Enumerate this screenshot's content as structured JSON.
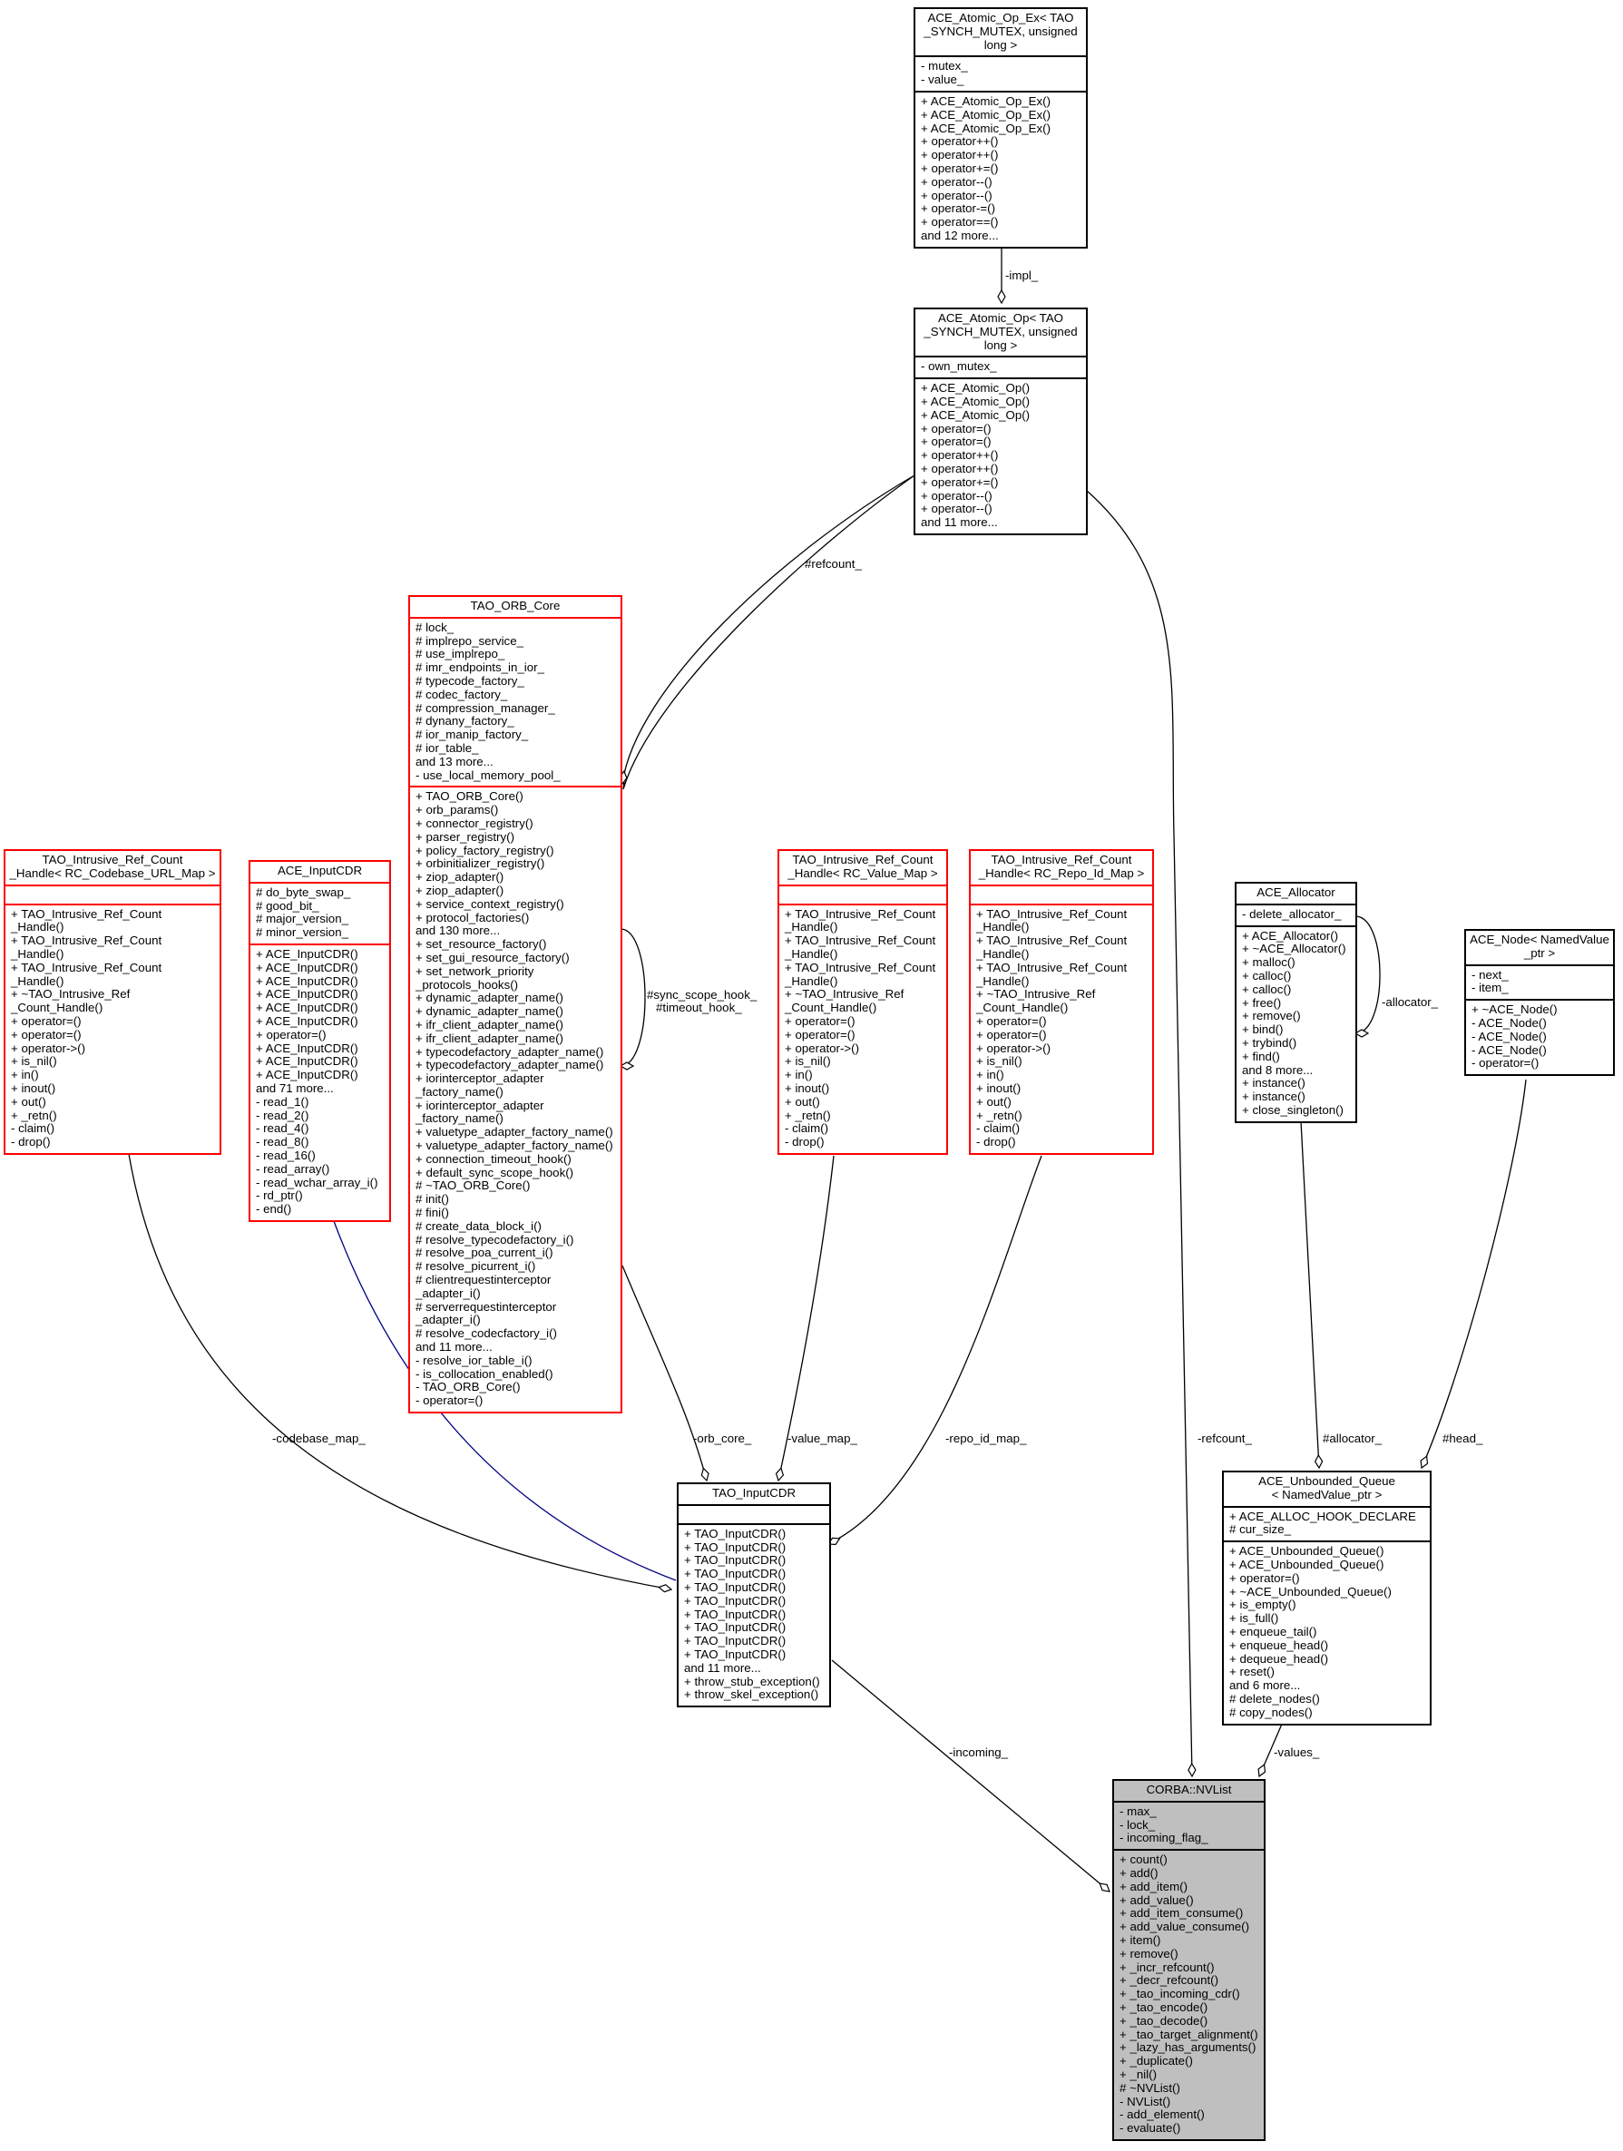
{
  "nodes": {
    "atomic_op_ex": {
      "title": [
        "ACE_Atomic_Op_Ex< TAO",
        "_SYNCH_MUTEX, unsigned",
        "long >"
      ],
      "attrs": [
        "- mutex_",
        "- value_"
      ],
      "ops": [
        "+ ACE_Atomic_Op_Ex()",
        "+ ACE_Atomic_Op_Ex()",
        "+ ACE_Atomic_Op_Ex()",
        "+ operator++()",
        "+ operator++()",
        "+ operator+=()",
        "+ operator--()",
        "+ operator--()",
        "+ operator-=()",
        "+ operator==()",
        "and 12 more..."
      ]
    },
    "atomic_op": {
      "title": [
        "ACE_Atomic_Op< TAO",
        "_SYNCH_MUTEX, unsigned",
        "long >"
      ],
      "attrs": [
        "- own_mutex_"
      ],
      "ops": [
        "+ ACE_Atomic_Op()",
        "+ ACE_Atomic_Op()",
        "+ ACE_Atomic_Op()",
        "+ operator=()",
        "+ operator=()",
        "+ operator++()",
        "+ operator++()",
        "+ operator+=()",
        "+ operator--()",
        "+ operator--()",
        "and 11 more..."
      ]
    },
    "orb_core": {
      "title": [
        "TAO_ORB_Core"
      ],
      "attrs": [
        "# lock_",
        "# implrepo_service_",
        "# use_implrepo_",
        "# imr_endpoints_in_ior_",
        "# typecode_factory_",
        "# codec_factory_",
        "# compression_manager_",
        "# dynany_factory_",
        "# ior_manip_factory_",
        "# ior_table_",
        "and 13 more...",
        "- use_local_memory_pool_"
      ],
      "ops": [
        "+ TAO_ORB_Core()",
        "+ orb_params()",
        "+ connector_registry()",
        "+ parser_registry()",
        "+ policy_factory_registry()",
        "+ orbinitializer_registry()",
        "+ ziop_adapter()",
        "+ ziop_adapter()",
        "+ service_context_registry()",
        "+ protocol_factories()",
        "and 130 more...",
        "+ set_resource_factory()",
        "+ set_gui_resource_factory()",
        "+ set_network_priority",
        "_protocols_hooks()",
        "+ dynamic_adapter_name()",
        "+ dynamic_adapter_name()",
        "+ ifr_client_adapter_name()",
        "+ ifr_client_adapter_name()",
        "+ typecodefactory_adapter_name()",
        "+ typecodefactory_adapter_name()",
        "+ iorinterceptor_adapter",
        "_factory_name()",
        "+ iorinterceptor_adapter",
        "_factory_name()",
        "+ valuetype_adapter_factory_name()",
        "+ valuetype_adapter_factory_name()",
        "+ connection_timeout_hook()",
        "+ default_sync_scope_hook()",
        "# ~TAO_ORB_Core()",
        "# init()",
        "# fini()",
        "# create_data_block_i()",
        "# resolve_typecodefactory_i()",
        "# resolve_poa_current_i()",
        "# resolve_picurrent_i()",
        "# clientrequestinterceptor",
        "_adapter_i()",
        "# serverrequestinterceptor",
        "_adapter_i()",
        "# resolve_codecfactory_i()",
        "and 11 more...",
        "- resolve_ior_table_i()",
        "- is_collocation_enabled()",
        "- TAO_ORB_Core()",
        "- operator=()"
      ]
    },
    "ref_codebase": {
      "title": [
        "TAO_Intrusive_Ref_Count",
        "_Handle< RC_Codebase_URL_Map >"
      ],
      "attrs": [],
      "ops": [
        "+ TAO_Intrusive_Ref_Count",
        "_Handle()",
        "+ TAO_Intrusive_Ref_Count",
        "_Handle()",
        "+ TAO_Intrusive_Ref_Count",
        "_Handle()",
        "+ ~TAO_Intrusive_Ref",
        "_Count_Handle()",
        "+ operator=()",
        "+ operator=()",
        "+ operator->()",
        "+ is_nil()",
        "+ in()",
        "+ inout()",
        "+ out()",
        "+ _retn()",
        "- claim()",
        "- drop()"
      ]
    },
    "ace_inputcdr": {
      "title": [
        "ACE_InputCDR"
      ],
      "attrs": [
        "# do_byte_swap_",
        "# good_bit_",
        "# major_version_",
        "# minor_version_"
      ],
      "ops": [
        "+ ACE_InputCDR()",
        "+ ACE_InputCDR()",
        "+ ACE_InputCDR()",
        "+ ACE_InputCDR()",
        "+ ACE_InputCDR()",
        "+ ACE_InputCDR()",
        "+ operator=()",
        "+ ACE_InputCDR()",
        "+ ACE_InputCDR()",
        "+ ACE_InputCDR()",
        "and 71 more...",
        "- read_1()",
        "- read_2()",
        "- read_4()",
        "- read_8()",
        "- read_16()",
        "- read_array()",
        "- read_wchar_array_i()",
        "- rd_ptr()",
        "- end()"
      ]
    },
    "ref_value": {
      "title": [
        "TAO_Intrusive_Ref_Count",
        "_Handle< RC_Value_Map >"
      ],
      "attrs": [],
      "ops": [
        "+ TAO_Intrusive_Ref_Count",
        "_Handle()",
        "+ TAO_Intrusive_Ref_Count",
        "_Handle()",
        "+ TAO_Intrusive_Ref_Count",
        "_Handle()",
        "+ ~TAO_Intrusive_Ref",
        "_Count_Handle()",
        "+ operator=()",
        "+ operator=()",
        "+ operator->()",
        "+ is_nil()",
        "+ in()",
        "+ inout()",
        "+ out()",
        "+ _retn()",
        "- claim()",
        "- drop()"
      ]
    },
    "ref_repo": {
      "title": [
        "TAO_Intrusive_Ref_Count",
        "_Handle< RC_Repo_Id_Map >"
      ],
      "attrs": [],
      "ops": [
        "+ TAO_Intrusive_Ref_Count",
        "_Handle()",
        "+ TAO_Intrusive_Ref_Count",
        "_Handle()",
        "+ TAO_Intrusive_Ref_Count",
        "_Handle()",
        "+ ~TAO_Intrusive_Ref",
        "_Count_Handle()",
        "+ operator=()",
        "+ operator=()",
        "+ operator->()",
        "+ is_nil()",
        "+ in()",
        "+ inout()",
        "+ out()",
        "+ _retn()",
        "- claim()",
        "- drop()"
      ]
    },
    "allocator": {
      "title": [
        "ACE_Allocator"
      ],
      "attrs": [
        "- delete_allocator_"
      ],
      "ops": [
        "+ ACE_Allocator()",
        "+ ~ACE_Allocator()",
        "+ malloc()",
        "+ calloc()",
        "+ calloc()",
        "+ free()",
        "+ remove()",
        "+ bind()",
        "+ trybind()",
        "+ find()",
        "and 8 more...",
        "+ instance()",
        "+ instance()",
        "+ close_singleton()"
      ]
    },
    "ace_node": {
      "title": [
        "ACE_Node< NamedValue",
        "_ptr >"
      ],
      "attrs": [
        "- next_",
        "- item_"
      ],
      "ops": [
        "+ ~ACE_Node()",
        "- ACE_Node()",
        "- ACE_Node()",
        "- ACE_Node()",
        "- operator=()"
      ]
    },
    "tao_inputcdr": {
      "title": [
        "TAO_InputCDR"
      ],
      "attrs": [],
      "ops": [
        "+ TAO_InputCDR()",
        "+ TAO_InputCDR()",
        "+ TAO_InputCDR()",
        "+ TAO_InputCDR()",
        "+ TAO_InputCDR()",
        "+ TAO_InputCDR()",
        "+ TAO_InputCDR()",
        "+ TAO_InputCDR()",
        "+ TAO_InputCDR()",
        "+ TAO_InputCDR()",
        "and 11 more...",
        "+ throw_stub_exception()",
        "+ throw_skel_exception()"
      ]
    },
    "unbounded_queue": {
      "title": [
        "ACE_Unbounded_Queue",
        "< NamedValue_ptr >"
      ],
      "attrs": [
        "+ ACE_ALLOC_HOOK_DECLARE",
        "# cur_size_"
      ],
      "ops": [
        "+ ACE_Unbounded_Queue()",
        "+ ACE_Unbounded_Queue()",
        "+ operator=()",
        "+ ~ACE_Unbounded_Queue()",
        "+ is_empty()",
        "+ is_full()",
        "+ enqueue_tail()",
        "+ enqueue_head()",
        "+ dequeue_head()",
        "+ reset()",
        "and 6 more...",
        "# delete_nodes()",
        "# copy_nodes()"
      ]
    },
    "nvlist": {
      "title": [
        "CORBA::NVList"
      ],
      "attrs": [
        "- max_",
        "- lock_",
        "- incoming_flag_"
      ],
      "ops": [
        "+ count()",
        "+ add()",
        "+ add_item()",
        "+ add_value()",
        "+ add_item_consume()",
        "+ add_value_consume()",
        "+ item()",
        "+ remove()",
        "+ _incr_refcount()",
        "+ _decr_refcount()",
        "+ _tao_incoming_cdr()",
        "+ _tao_encode()",
        "+ _tao_decode()",
        "+ _tao_target_alignment()",
        "+ _lazy_has_arguments()",
        "+ _duplicate()",
        "+ _nil()",
        "# ~NVList()",
        "- NVList()",
        "- add_element()",
        "- evaluate()"
      ]
    }
  },
  "edges": {
    "impl": "-impl_",
    "refcount_orb": "#refcount_",
    "sync_scope": "#sync_scope_hook_",
    "timeout_hook": "#timeout_hook_",
    "codebase_map": "-codebase_map_",
    "orb_core": "-orb_core_",
    "value_map": "-value_map_",
    "repo_id_map": "-repo_id_map_",
    "refcount_nv": "-refcount_",
    "allocator_self": "-allocator_",
    "allocator_q": "#allocator_",
    "head": "#head_",
    "incoming": "-incoming_",
    "values": "-values_"
  },
  "colors": {
    "border_default": "#000000",
    "border_incomplete": "#ff0000",
    "inheritance": "#000080",
    "highlight_fill": "#bfbfbf"
  }
}
